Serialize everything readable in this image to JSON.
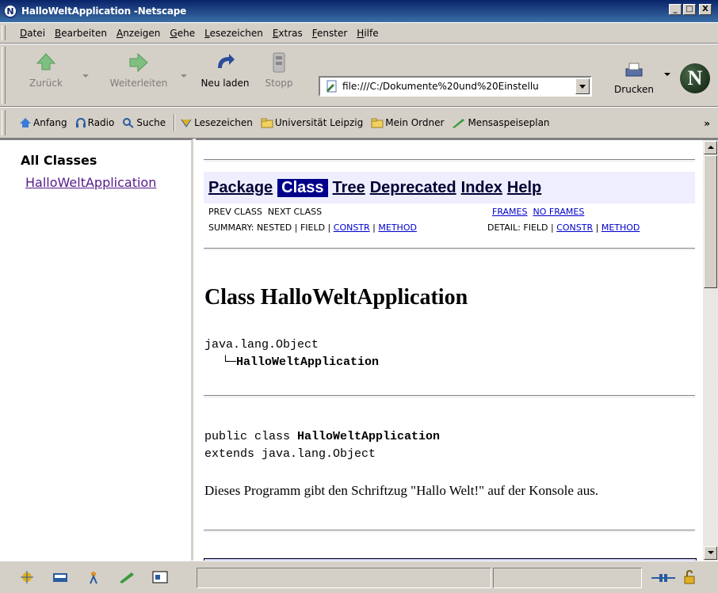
{
  "window": {
    "title": "HalloWeltApplication -Netscape",
    "minimize": "_",
    "maximize": "□",
    "close": "X"
  },
  "menu": {
    "items": [
      {
        "label": "Datei",
        "key": "D"
      },
      {
        "label": "Bearbeiten",
        "key": "B"
      },
      {
        "label": "Anzeigen",
        "key": "A"
      },
      {
        "label": "Gehe",
        "key": "G"
      },
      {
        "label": "Lesezeichen",
        "key": "L"
      },
      {
        "label": "Extras",
        "key": "E"
      },
      {
        "label": "Fenster",
        "key": "F"
      },
      {
        "label": "Hilfe",
        "key": "H"
      }
    ]
  },
  "nav": {
    "back": "Zurück",
    "forward": "Weiterleiten",
    "reload": "Neu laden",
    "stop": "Stopp",
    "url": "file:///C:/Dokumente%20und%20Einstellu",
    "print": "Drucken",
    "logo": "N"
  },
  "personal": {
    "items": [
      "Anfang",
      "Radio",
      "Suche",
      "Lesezeichen",
      "Universität Leipzig",
      "Mein Ordner",
      "Mensaspeiseplan"
    ],
    "more": "»"
  },
  "left_frame": {
    "heading": "All Classes",
    "classes": [
      "HalloWeltApplication"
    ]
  },
  "doc": {
    "navbar": {
      "package": "Package",
      "class": "Class",
      "tree": "Tree",
      "deprecated": "Deprecated",
      "index": "Index",
      "help": "Help"
    },
    "prev_class": "PREV CLASS",
    "next_class": "NEXT CLASS",
    "frames": "FRAMES",
    "no_frames": "NO FRAMES",
    "summary_prefix": "SUMMARY: NESTED | FIELD | ",
    "summary_constr": "CONSTR",
    "sep": " | ",
    "summary_method": "METHOD",
    "detail_prefix": "DETAIL: FIELD | ",
    "detail_constr": "CONSTR",
    "detail_method": "METHOD",
    "class_title": "Class HalloWeltApplication",
    "hierarchy_root": "java.lang.Object",
    "hierarchy_branch": "└─",
    "hierarchy_leaf": "HalloWeltApplication",
    "decl_prefix": "public class ",
    "decl_name": "HalloWeltApplication",
    "decl_extends": "extends java.lang.Object",
    "description": "Dieses Programm gibt den Schriftzug \"Hallo Welt!\" auf der Konsole aus."
  }
}
